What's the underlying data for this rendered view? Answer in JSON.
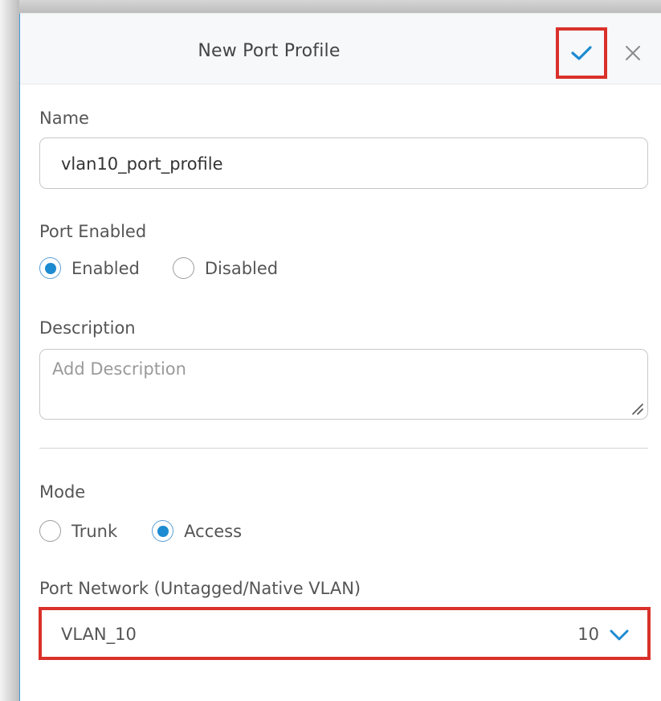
{
  "dialog": {
    "title": "New Port Profile"
  },
  "form": {
    "name_label": "Name",
    "name_value": "vlan10_port_profile",
    "port_enabled_label": "Port Enabled",
    "port_enabled_options": [
      "Enabled",
      "Disabled"
    ],
    "port_enabled_selected": "Enabled",
    "description_label": "Description",
    "description_placeholder": "Add Description",
    "mode_label": "Mode",
    "mode_options": [
      "Trunk",
      "Access"
    ],
    "mode_selected": "Access",
    "port_network_label": "Port Network (Untagged/Native VLAN)",
    "port_network_name": "VLAN_10",
    "port_network_id": "10"
  },
  "icons": {
    "confirm": "checkmark-icon",
    "close": "close-icon",
    "dropdown": "chevron-down-icon"
  },
  "colors": {
    "accent": "#1d8bd1",
    "highlight": "#d9312a"
  }
}
